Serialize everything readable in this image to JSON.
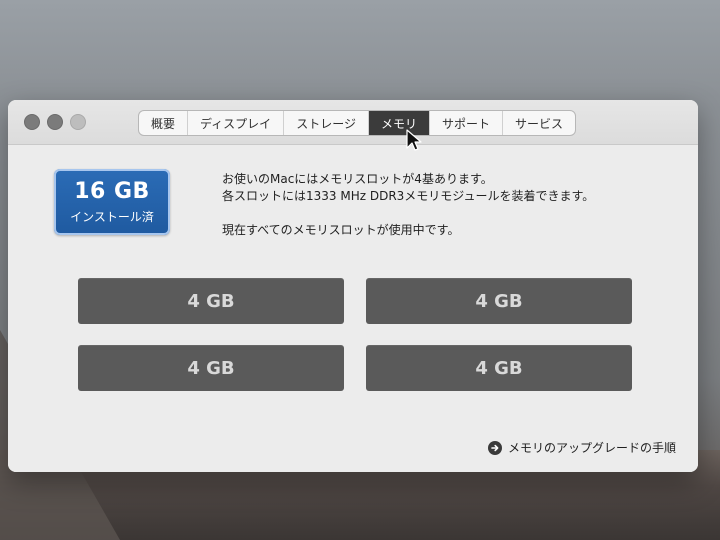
{
  "window": {
    "tabs": [
      {
        "label": "概要"
      },
      {
        "label": "ディスプレイ"
      },
      {
        "label": "ストレージ"
      },
      {
        "label": "メモリ",
        "active": true
      },
      {
        "label": "サポート"
      },
      {
        "label": "サービス"
      }
    ]
  },
  "memory": {
    "installed_capacity": "16 GB",
    "installed_label": "インストール済",
    "info_lines": [
      "お使いのMacにはメモリスロットが4基あります。",
      "各スロットには1333 MHz DDR3メモリモジュールを装着できます。",
      "現在すべてのメモリスロットが使用中です。"
    ],
    "slots": [
      "4 GB",
      "4 GB",
      "4 GB",
      "4 GB"
    ],
    "upgrade_link": "メモリのアップグレードの手順"
  },
  "icons": {
    "window_close": "close-icon",
    "window_minimize": "minimize-icon",
    "window_zoom": "zoom-icon",
    "upgrade_arrow": "arrow-right-circle-icon",
    "pointer": "mouse-pointer-icon"
  },
  "colors": {
    "accent": "#2b6cb6",
    "slot_bg": "#5a5a5a",
    "active_tab_bg": "#3b3b3b"
  }
}
